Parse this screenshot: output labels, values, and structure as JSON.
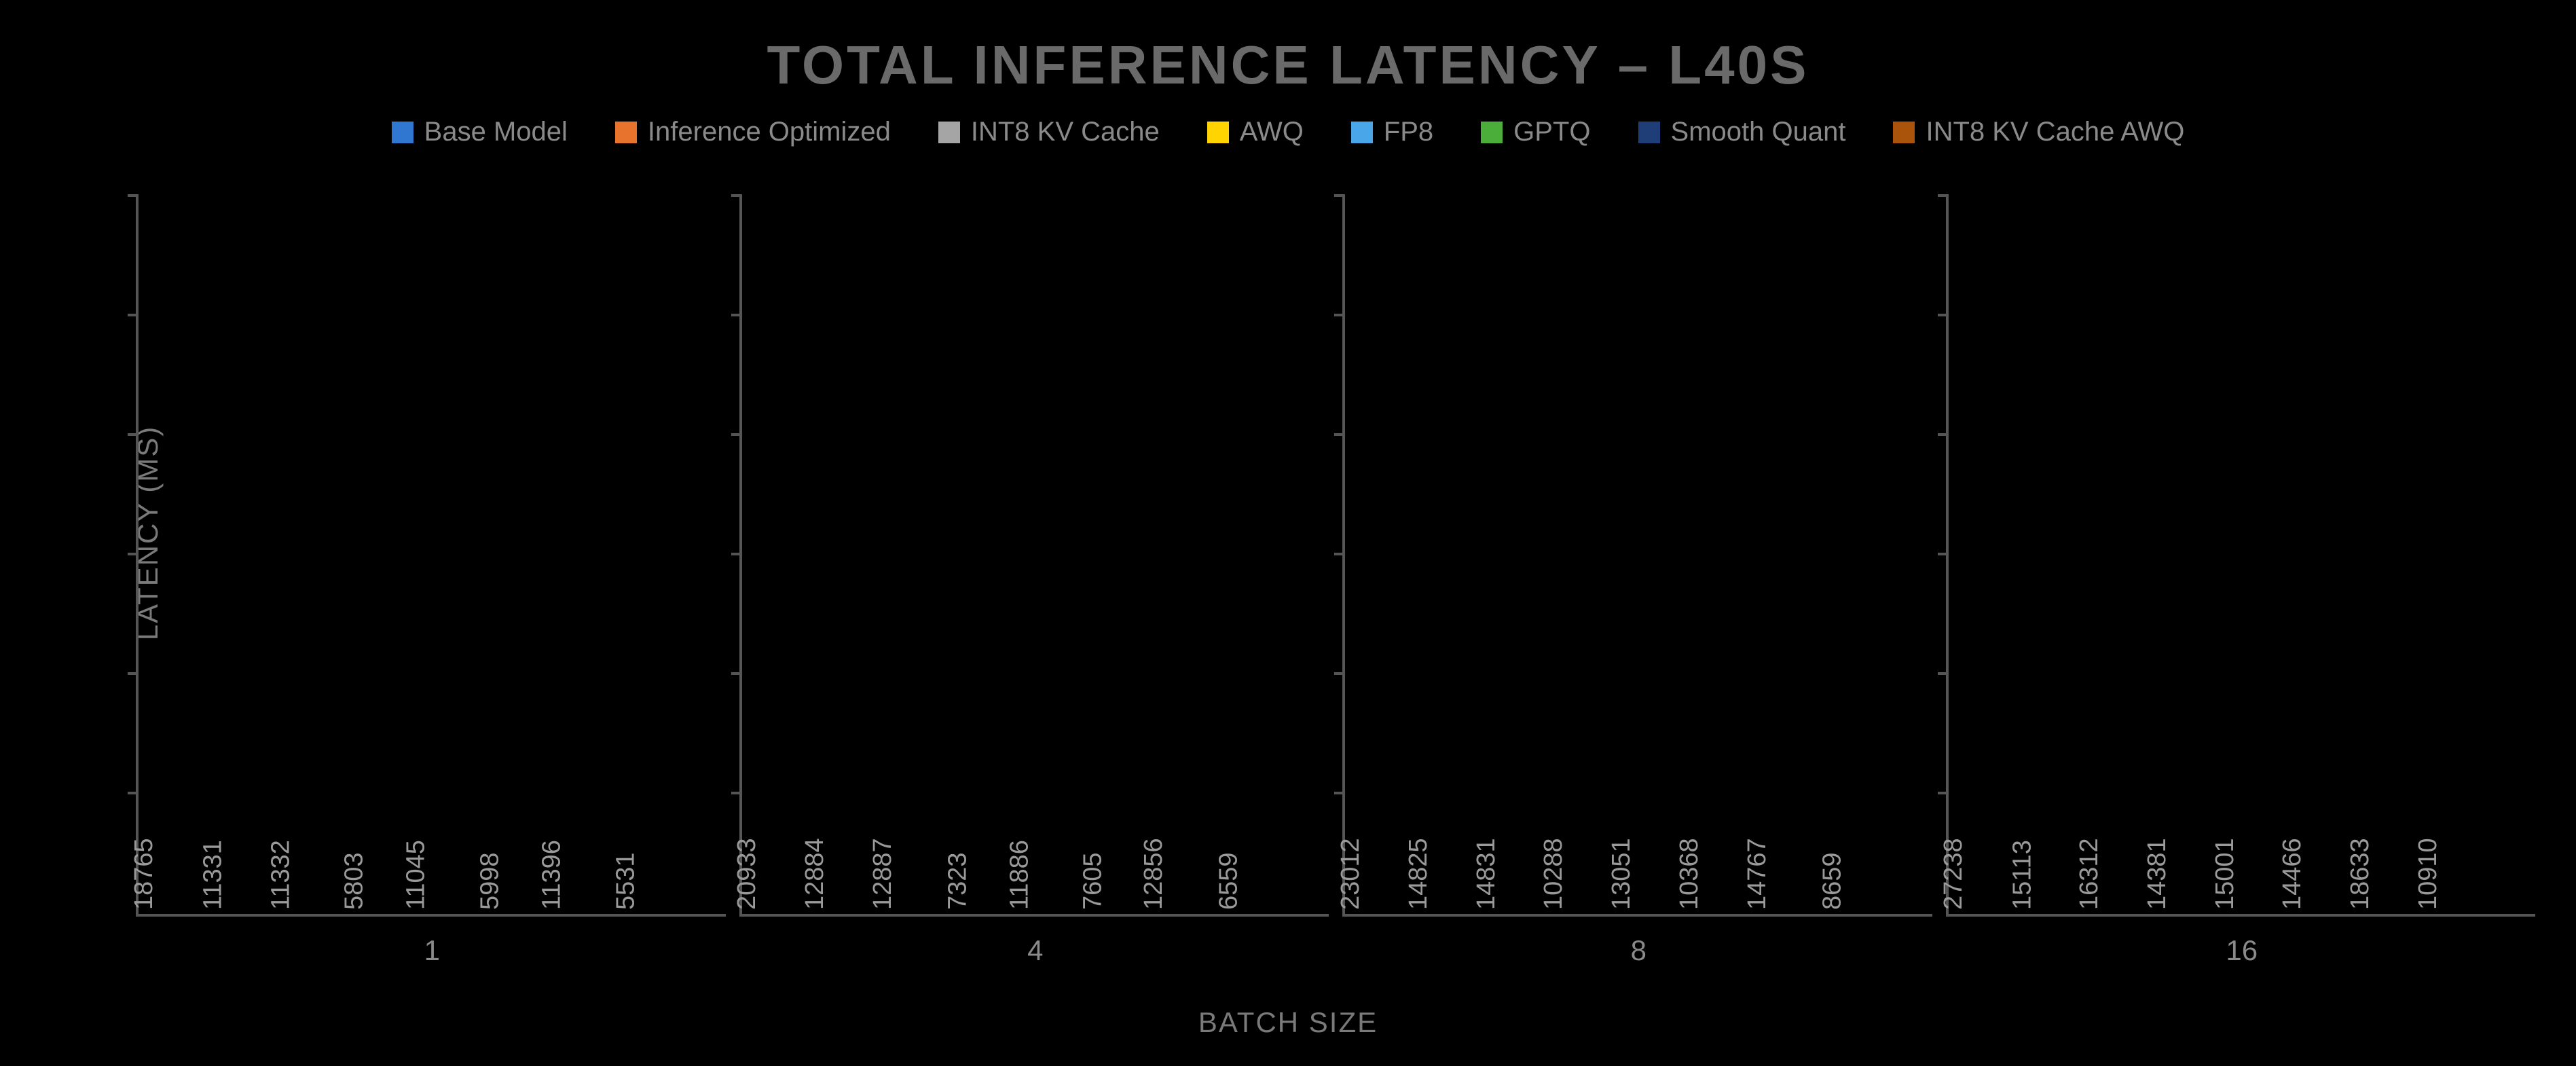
{
  "chart_data": {
    "type": "bar",
    "title": "TOTAL INFERENCE LATENCY – L40S",
    "xlabel": "BATCH SIZE",
    "ylabel": "LATENCY (MS)",
    "ylim": [
      0,
      30000
    ],
    "categories": [
      "1",
      "4",
      "8",
      "16"
    ],
    "series": [
      {
        "name": "Base Model",
        "color": "#2f77d1",
        "values": [
          18765,
          20933,
          23012,
          27238
        ]
      },
      {
        "name": "Inference Optimized",
        "color": "#e8732c",
        "values": [
          11331,
          12884,
          14825,
          15113
        ]
      },
      {
        "name": "INT8 KV Cache",
        "color": "#a5a5a5",
        "values": [
          11332,
          12887,
          14831,
          16312
        ]
      },
      {
        "name": "AWQ",
        "color": "#ffd400",
        "values": [
          5803,
          7323,
          10288,
          14381
        ]
      },
      {
        "name": "FP8",
        "color": "#49a6e8",
        "values": [
          11045,
          11886,
          13051,
          15001
        ]
      },
      {
        "name": "GPTQ",
        "color": "#4bae3a",
        "values": [
          5998,
          7605,
          10368,
          14466
        ]
      },
      {
        "name": "Smooth Quant",
        "color": "#1f3e78",
        "values": [
          11396,
          12856,
          14767,
          18633
        ]
      },
      {
        "name": "INT8 KV Cache AWQ",
        "color": "#a9530b",
        "values": [
          5531,
          6559,
          8659,
          10910
        ]
      }
    ]
  }
}
